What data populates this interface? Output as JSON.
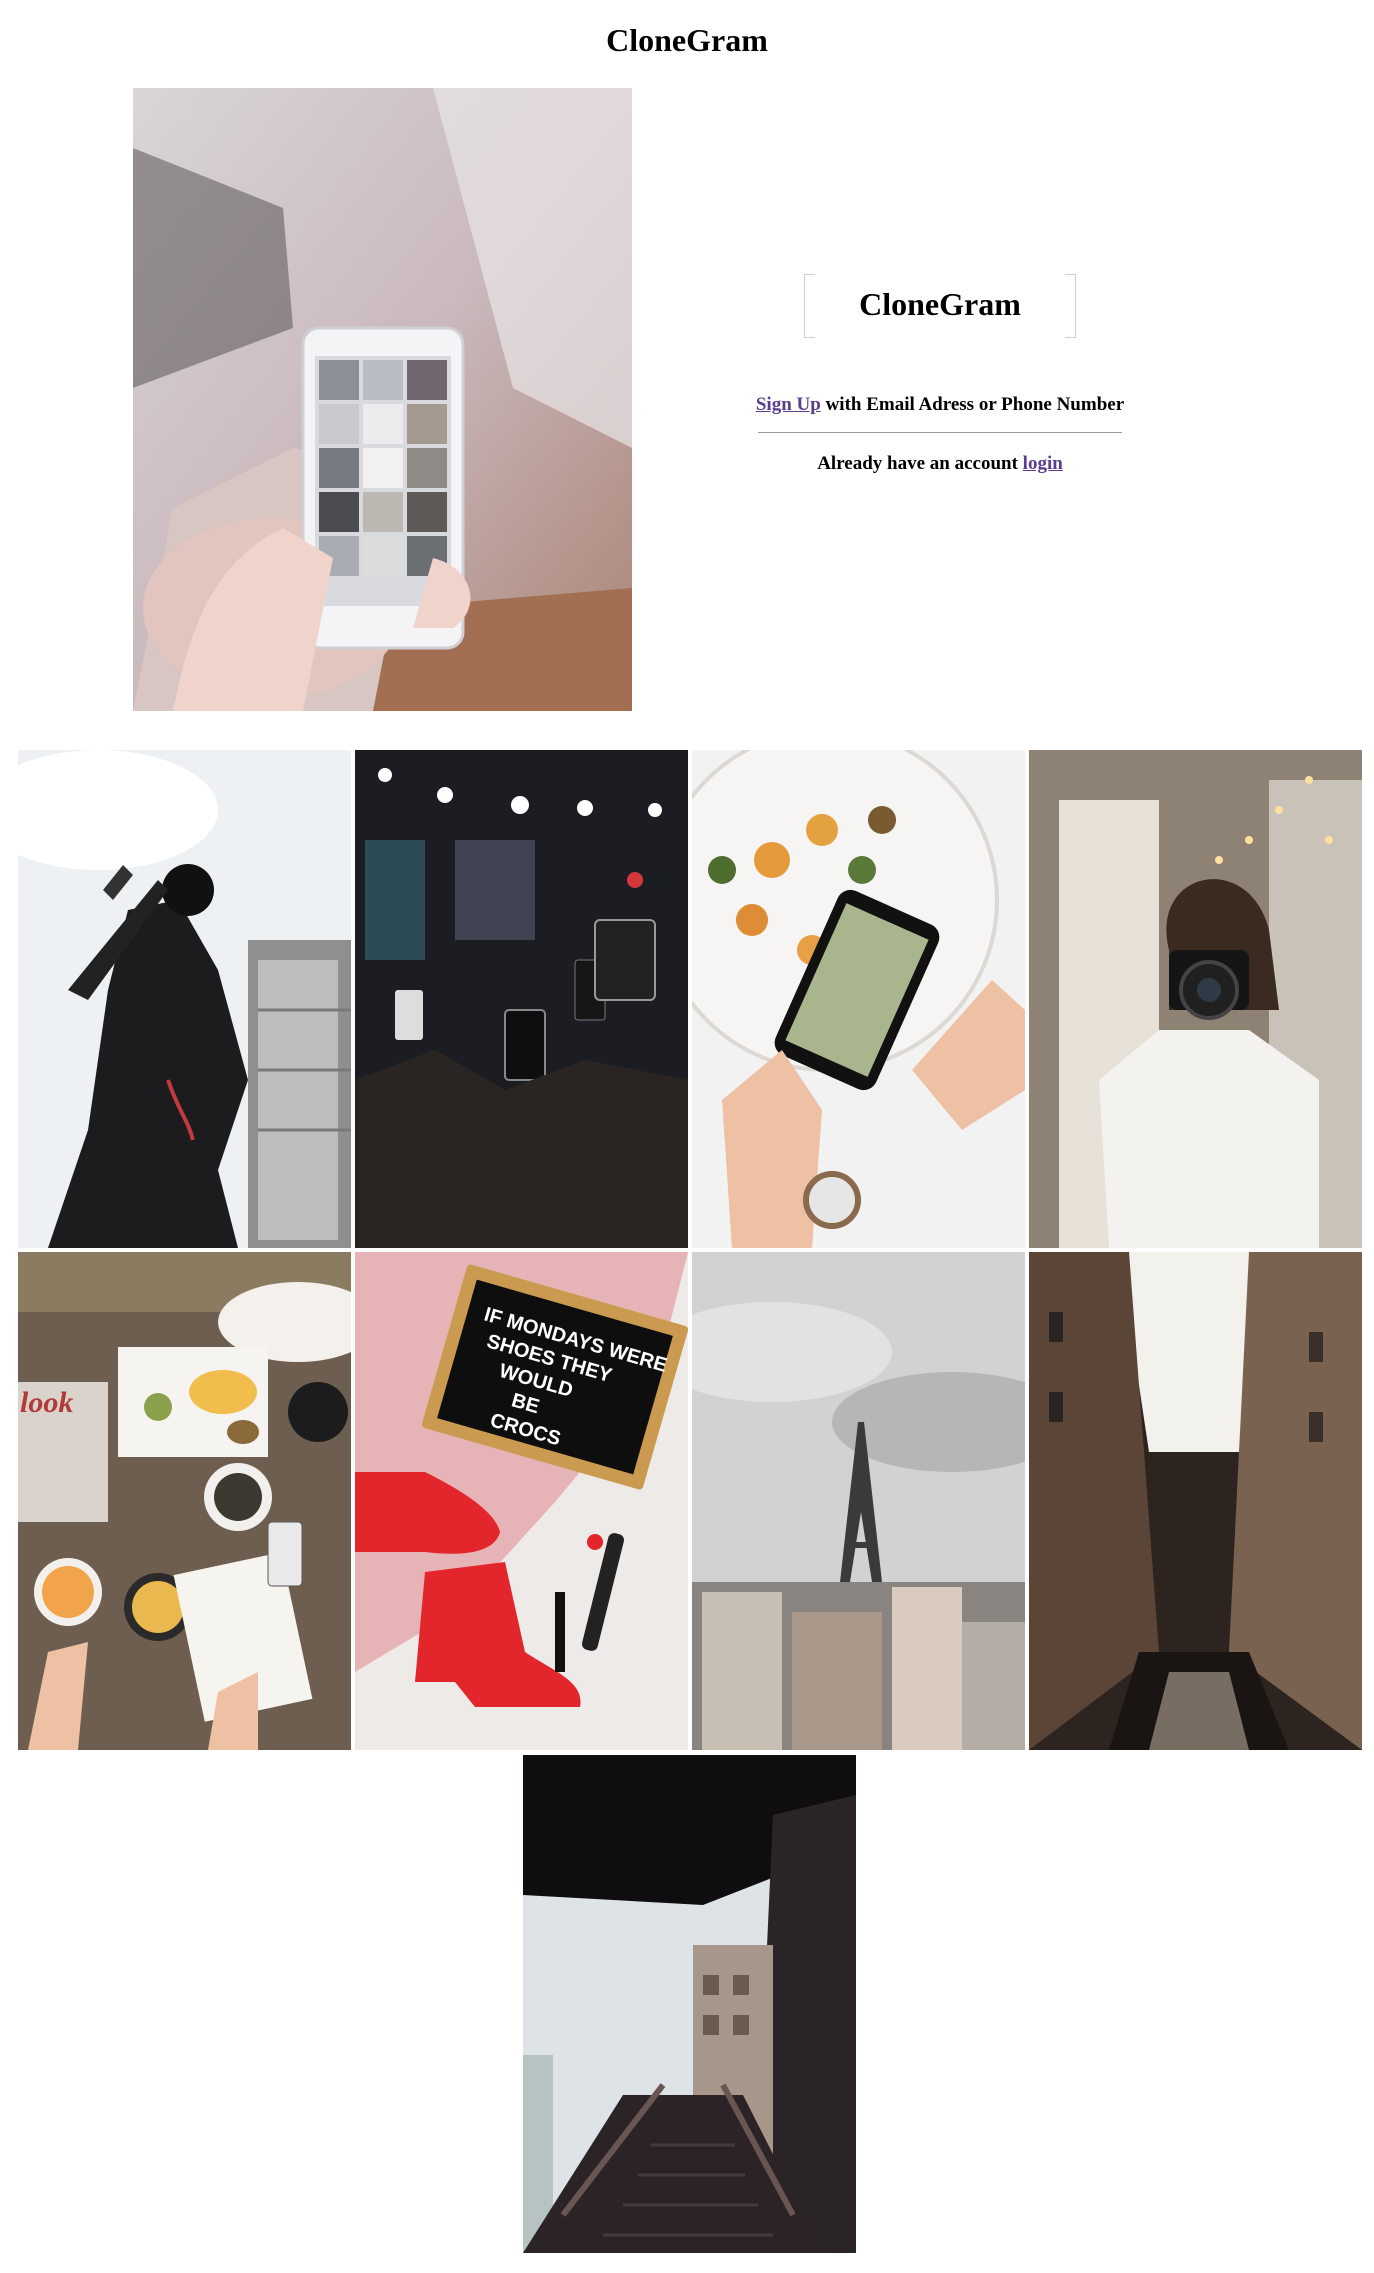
{
  "page": {
    "title": "CloneGram"
  },
  "hero": {
    "alt": "hand holding phone showing a photo feed"
  },
  "auth": {
    "logo": "CloneGram",
    "signup_link": "Sign Up",
    "signup_rest": " with Email Adress or Phone Number",
    "login_prefix": "Already have an account ",
    "login_link": "login"
  },
  "gallery": {
    "photos": [
      {
        "icon": "person-with-rifle-photo"
      },
      {
        "icon": "concert-crowd-phones-photo"
      },
      {
        "icon": "photographing-food-photo"
      },
      {
        "icon": "woman-with-camera-photo"
      },
      {
        "icon": "breakfast-flatlay-photo"
      },
      {
        "icon": "red-boots-letterboard-photo"
      },
      {
        "icon": "eiffel-tower-rooftops-photo"
      },
      {
        "icon": "venice-canal-photo"
      },
      {
        "icon": "stairway-photo"
      }
    ],
    "letterboard_text": [
      "IF MONDAYS WERE",
      "SHOES THEY",
      "WOULD",
      "BE",
      "CROCS"
    ],
    "magazine_text": "look"
  }
}
